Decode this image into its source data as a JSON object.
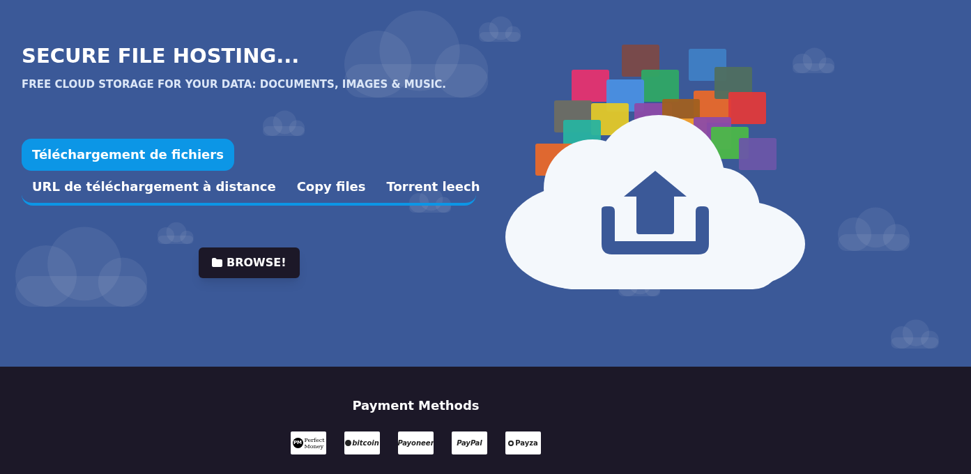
{
  "hero": {
    "title": "SECURE FILE HOSTING...",
    "subtitle": "FREE CLOUD STORAGE FOR YOUR DATA: DOCUMENTS, IMAGES & MUSIC."
  },
  "tabs": [
    {
      "label": "Téléchargement de fichiers",
      "selected": true
    },
    {
      "label": "URL de téléchargement à distance",
      "selected": false
    },
    {
      "label": "Copy files",
      "selected": false
    },
    {
      "label": "Torrent leech",
      "selected": false
    }
  ],
  "browse_button": {
    "label": "BROWSE!"
  },
  "footer": {
    "heading": "Payment Methods",
    "payment_methods": [
      {
        "kind": "perfectmoney",
        "badge": "PM",
        "lines": [
          "Perfect",
          "Money"
        ]
      },
      {
        "kind": "bitcoin",
        "lines": [
          "bitcoin"
        ]
      },
      {
        "kind": "payoneer",
        "lines": [
          "Payoneer"
        ]
      },
      {
        "kind": "paypal",
        "lines": [
          "PayPal"
        ]
      },
      {
        "kind": "payza",
        "lines": [
          "Payza"
        ]
      }
    ]
  }
}
